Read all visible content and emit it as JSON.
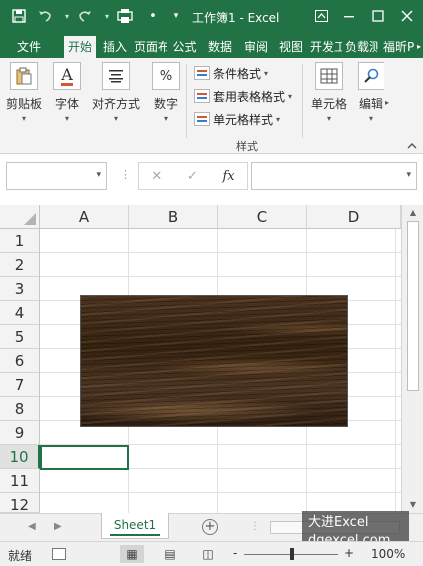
{
  "window": {
    "title": "工作簿1 - Excel",
    "save_icon": "save-icon",
    "undo_icon": "undo-icon",
    "redo_icon": "redo-icon",
    "print_preview_icon": "print-preview-icon",
    "qat_dot": "•",
    "qat_dropdown": "▾",
    "ribbon_display_icon": "ribbon-display-icon",
    "minimize_icon": "minimize-icon",
    "maximize_icon": "maximize-icon",
    "close_icon": "close-icon",
    "accent_color": "#217346"
  },
  "ribbon": {
    "tabs": [
      {
        "label": "文件"
      },
      {
        "label": "开始"
      },
      {
        "label": "插入"
      },
      {
        "label": "页面布局"
      },
      {
        "label": "公式"
      },
      {
        "label": "数据"
      },
      {
        "label": "审阅"
      },
      {
        "label": "视图"
      },
      {
        "label": "开发工具"
      },
      {
        "label": "负载测试"
      },
      {
        "label": "福昕PDF"
      }
    ],
    "active_tab": "开始",
    "groups": {
      "clipboard": "剪贴板",
      "font": "字体",
      "alignment": "对齐方式",
      "number": "数字",
      "cells": "单元格",
      "editing": "编辑"
    },
    "icons": {
      "font_glyph": "A",
      "number_glyph": "%"
    },
    "styles": {
      "conditional_format": "条件格式",
      "table_format": "套用表格格式",
      "cell_styles": "单元格样式",
      "group_label": "样式"
    }
  },
  "formula_bar": {
    "name_box": "",
    "formula": "",
    "cancel_icon": "✕",
    "enter_icon": "✓",
    "fx_label": "fx"
  },
  "grid": {
    "columns": [
      "A",
      "B",
      "C",
      "D"
    ],
    "rows": [
      "1",
      "2",
      "3",
      "4",
      "5",
      "6",
      "7",
      "8",
      "9",
      "10",
      "11",
      "12"
    ],
    "selected_row": "10",
    "image_description": "wood-texture-picture"
  },
  "sheets": {
    "tabs": [
      {
        "name": "Sheet1"
      }
    ],
    "add_icon": "+"
  },
  "watermark": {
    "line1": "大进Excel",
    "line2": "dqexcel.com"
  },
  "status": {
    "ready_text": "就绪",
    "zoom_minus": "-",
    "zoom_plus": "+",
    "zoom_level": "100%"
  }
}
